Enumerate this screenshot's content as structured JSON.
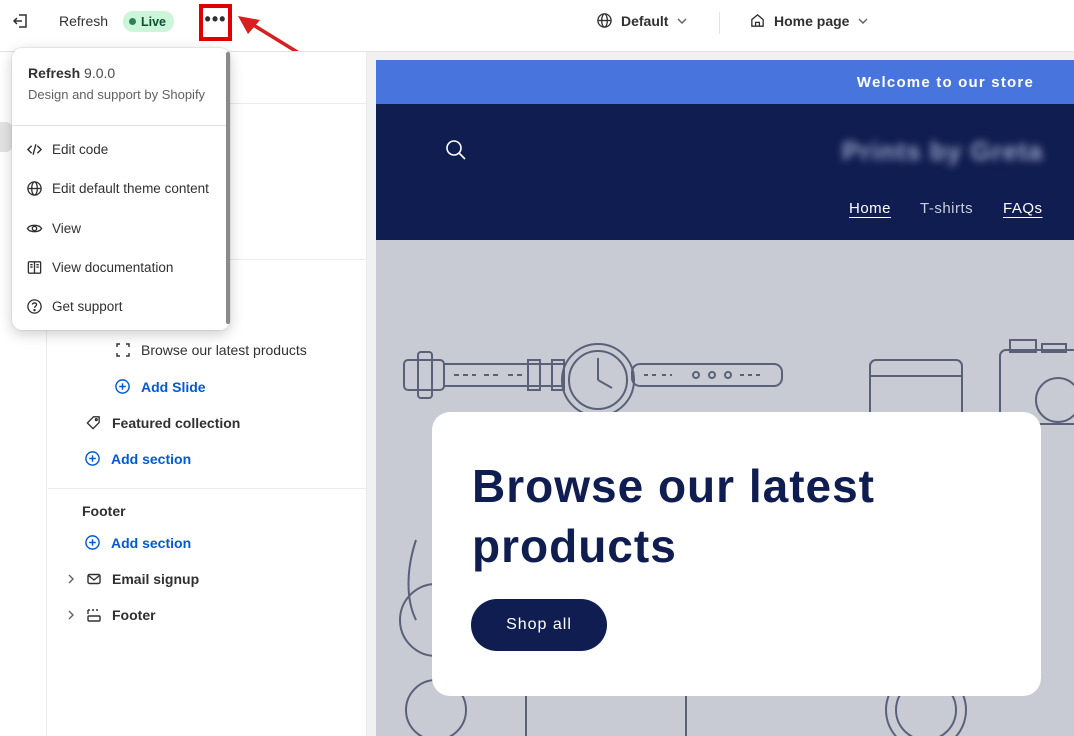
{
  "topbar": {
    "app_title": "Refresh",
    "status_badge": "Live",
    "more_label": "•••",
    "theme_select": "Default",
    "page_select": "Home page"
  },
  "menu": {
    "theme_name": "Refresh",
    "version": "9.0.0",
    "subtitle": "Design and support by Shopify",
    "items": [
      {
        "label": "Edit code",
        "icon": "code-icon"
      },
      {
        "label": "Edit default theme content",
        "icon": "globe-icon"
      },
      {
        "label": "View",
        "icon": "eye-icon"
      },
      {
        "label": "View documentation",
        "icon": "book-icon"
      },
      {
        "label": "Get support",
        "icon": "question-icon"
      }
    ]
  },
  "sidebar": {
    "slide_item": "Browse our latest products",
    "add_slide": "Add Slide",
    "featured_collection": "Featured collection",
    "add_section_1": "Add section",
    "footer_heading": "Footer",
    "add_section_2": "Add section",
    "email_signup": "Email signup",
    "footer_item": "Footer"
  },
  "preview": {
    "announcement": "Welcome to our store",
    "store_logo": "Prints by Greta",
    "nav": [
      "Home",
      "T-shirts",
      "FAQs"
    ],
    "hero_title": "Browse our latest products",
    "hero_button": "Shop all"
  },
  "colors": {
    "accent_blue": "#005bd3",
    "live_green": "#29845a",
    "annotation_red": "#e00000",
    "store_navy": "#0f1d50",
    "announcement_blue": "#4775dd"
  }
}
